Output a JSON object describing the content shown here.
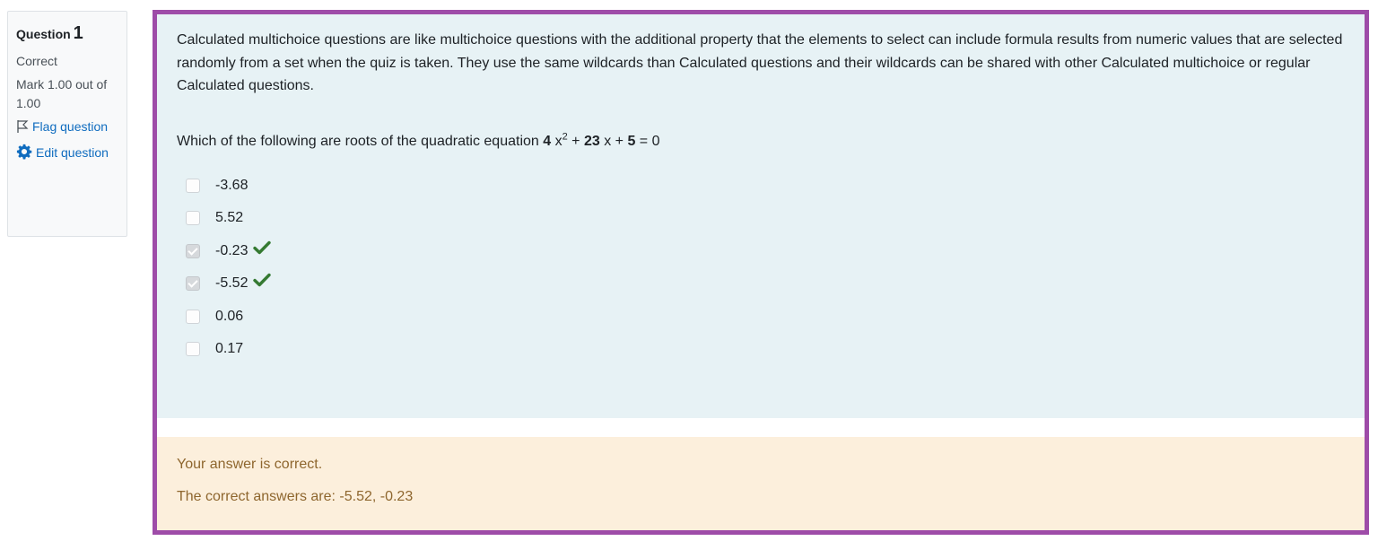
{
  "info": {
    "question_word": "Question",
    "question_number": "1",
    "state": "Correct",
    "grade": "Mark 1.00 out of 1.00",
    "flag_label": "Flag question",
    "edit_label": "Edit question"
  },
  "question": {
    "intro": "Calculated multichoice questions are like multichoice questions with the additional property that the elements to select can include formula results from numeric values that are selected randomly from a set when the quiz is taken. They use the same wildcards than Calculated questions and their wildcards can be shared with other Calculated multichoice or regular Calculated questions.",
    "prompt_prefix": "Which of the following are roots of the quadratic equation ",
    "coef_a": "4",
    "x1": " x",
    "exp": "2",
    "plus1": " + ",
    "coef_b": "23",
    "x2": " x + ",
    "coef_c": "5",
    "equals": " = 0",
    "answers": [
      {
        "value": "-3.68",
        "checked": false,
        "correct": false
      },
      {
        "value": "5.52",
        "checked": false,
        "correct": false
      },
      {
        "value": "-0.23",
        "checked": true,
        "correct": true
      },
      {
        "value": "-5.52",
        "checked": true,
        "correct": true
      },
      {
        "value": "0.06",
        "checked": false,
        "correct": false
      },
      {
        "value": "0.17",
        "checked": false,
        "correct": false
      }
    ]
  },
  "feedback": {
    "result": "Your answer is correct.",
    "right_answer": "The correct answers are: -5.52, -0.23"
  },
  "colors": {
    "frame": "#9e4ca8",
    "content_bg": "#e7f2f5",
    "feedback_bg": "#fcefdc",
    "feedback_text": "#8e662e",
    "link": "#0f6cbf",
    "tick": "#357a32"
  }
}
